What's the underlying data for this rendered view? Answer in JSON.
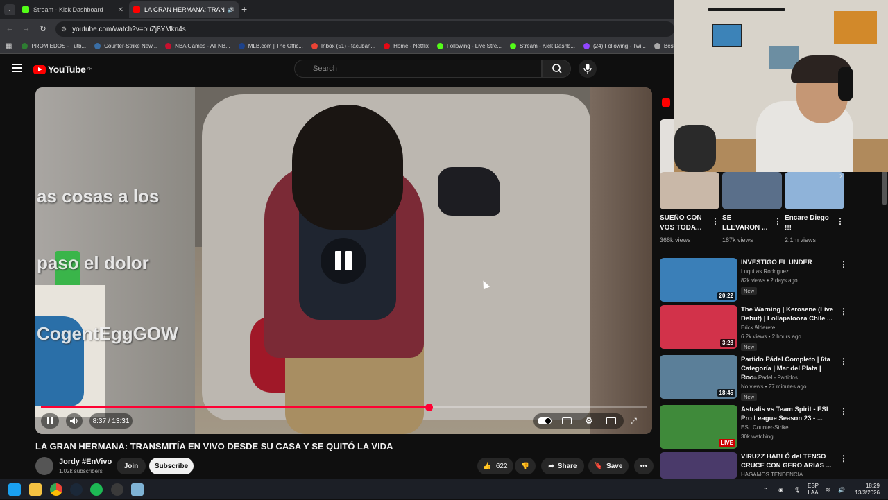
{
  "browser": {
    "tabs": [
      {
        "label": "Stream - Kick Dashboard",
        "active": false,
        "favicon_color": "#53fc18"
      },
      {
        "label": "LA GRAN HERMANA: TRAN",
        "active": true,
        "favicon_color": "#ff0000"
      }
    ],
    "new_tab": "+",
    "url": "youtube.com/watch?v=ouZj8YMkn4s",
    "bookmarks": [
      {
        "label": "PROMIEDOS - Futb...",
        "color": "#2e7d32"
      },
      {
        "label": "Counter-Strike New...",
        "color": "#3a6ea5"
      },
      {
        "label": "NBA Games - All NB...",
        "color": "#c8102e"
      },
      {
        "label": "MLB.com | The Offic...",
        "color": "#1d428a"
      },
      {
        "label": "Inbox (51) - facuban...",
        "color": "#ea4335"
      },
      {
        "label": "Home - Netflix",
        "color": "#e50914"
      },
      {
        "label": "Following - Live Stre...",
        "color": "#53fc18"
      },
      {
        "label": "Stream - Kick Dashb...",
        "color": "#53fc18"
      },
      {
        "label": "(24) Following - Twi...",
        "color": "#9146ff"
      },
      {
        "label": "Best F",
        "color": "#aaaaaa"
      }
    ]
  },
  "youtube": {
    "logo_text": "YouTube",
    "region": "AR",
    "search_placeholder": "Search"
  },
  "video": {
    "subtitle_lines": [
      "as cosas a los",
      "paso el dolor",
      "CogentEggGOW"
    ],
    "progress_fraction": 0.64,
    "time": "8:37 / 13:31",
    "title": "LA GRAN HERMANA: TRANSMITÍA EN VIVO DESDE SU CASA Y SE QUITÓ LA VIDA",
    "channel": "Jordy #EnVivo",
    "subscribers": "1.02k subscribers",
    "join_label": "Join",
    "subscribe_label": "Subscribe",
    "likes": "622",
    "share_label": "Share",
    "save_label": "Save"
  },
  "shorts": [
    {
      "title": "SUEÑO CON VOS TODA...",
      "views": "368k views",
      "color": "#c9b8a8"
    },
    {
      "title": "SE LLEVARON ...",
      "views": "187k views",
      "color": "#5a6f8a"
    },
    {
      "title": "Encare Diego !!!",
      "views": "2.1m views",
      "color": "#8fb3d9"
    }
  ],
  "recommendations": [
    {
      "title": "INVESTIGO EL UNDER",
      "channel": "Luquitas Rodriguez",
      "meta": "82k views • 2 days ago",
      "badge": "New",
      "duration": "20:22",
      "thumb_color": "#3a7fb8",
      "live": false
    },
    {
      "title": "The Warning | Kerosene (Live Debut) | Lollapalooza Chile ...",
      "channel": "Erick Alderete",
      "meta": "6.2k views • 2 hours ago",
      "badge": "New",
      "duration": "3:28",
      "thumb_color": "#d2324a",
      "live": false
    },
    {
      "title": "Partido Pádel Completo | 6ta Categoría | Mar del Plata | Roc...",
      "channel": "Scatto Padel - Partidos",
      "meta": "No views • 27 minutes ago",
      "badge": "New",
      "duration": "18:45",
      "thumb_color": "#5b7f99",
      "live": false
    },
    {
      "title": "Astralis vs Team Spirit - ESL Pro League Season 23 - ...",
      "channel": "ESL Counter-Strike",
      "meta": "30k watching",
      "badge": "",
      "duration": "LIVE",
      "thumb_color": "#3f8a3a",
      "live": true
    },
    {
      "title": "VIRUZZ HABLÓ del TENSO CRUCE CON GERO ARIAS ...",
      "channel": "HAGAMOS TENDENCIA",
      "meta": "",
      "badge": "",
      "duration": "",
      "thumb_color": "#4a3a6a",
      "live": false
    }
  ],
  "taskbar": {
    "lang_top": "ESP",
    "lang_bottom": "LAA",
    "time": "18:29",
    "date": "13/3/2026"
  },
  "colors": {
    "accent": "#ff0033",
    "bg": "#0f0f0f"
  }
}
